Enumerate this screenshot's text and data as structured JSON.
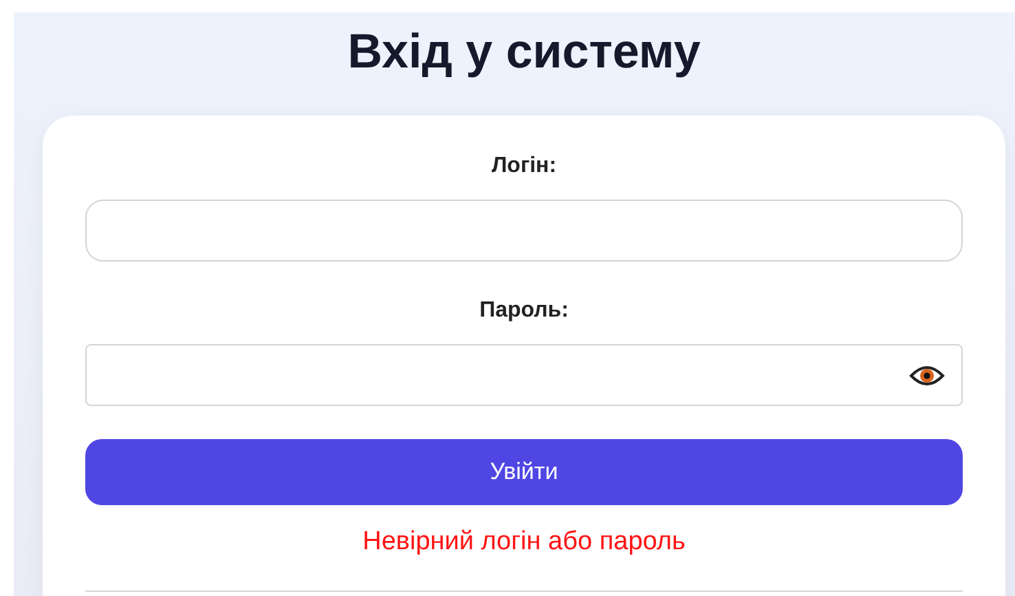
{
  "title": "Вхід у систему",
  "fields": [
    {
      "label": "Логін:",
      "kind": "text",
      "reveal_toggle": false
    },
    {
      "label": "Пароль:",
      "kind": "password",
      "reveal_toggle": true
    }
  ],
  "submit_button": "Увійти",
  "error_message": "Невірний логін або пароль"
}
